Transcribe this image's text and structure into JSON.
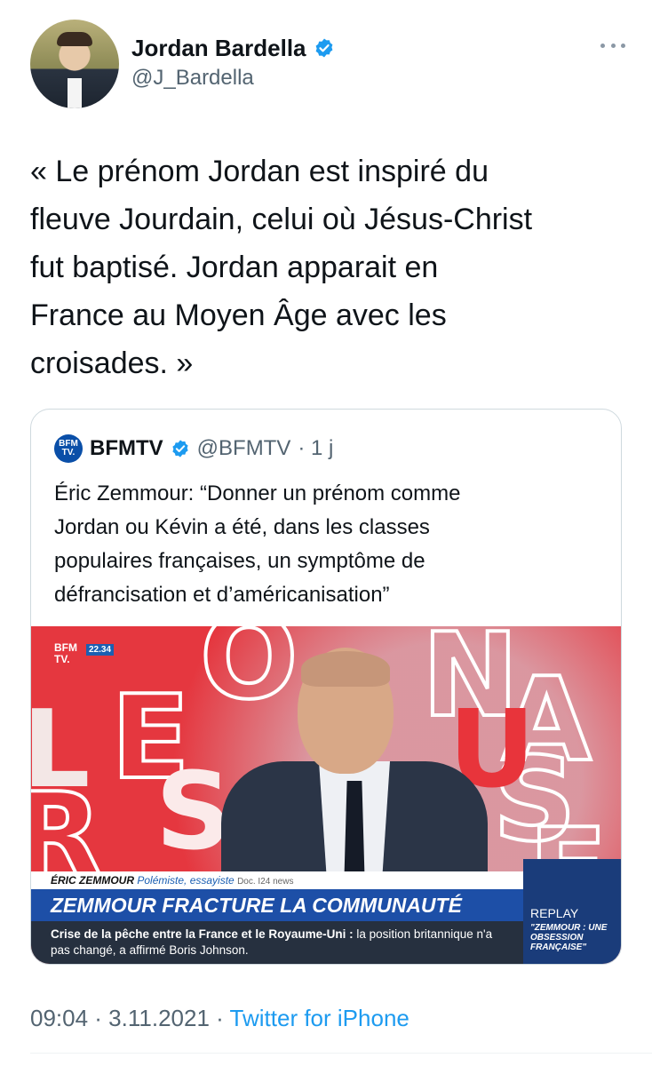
{
  "tweet": {
    "author": {
      "display_name": "Jordan Bardella",
      "handle": "@J_Bardella",
      "verified": true
    },
    "text": "« Le prénom Jordan est inspiré du\nfleuve Jourdain, celui où Jésus-Christ\nfut baptisé. Jordan apparait en\nFrance au Moyen Âge avec les\ncroisades. »",
    "timestamp": "09:04 · 3.11.2021 · ",
    "source": "Twitter for iPhone"
  },
  "quoted_tweet": {
    "logo_text": "BFM TV.",
    "display_name": "BFMTV",
    "handle": "@BFMTV",
    "age": "· 1 j",
    "text": "Éric Zemmour: “Donner un prénom comme\nJordan ou Kévin a été, dans les classes\npopulaires françaises, un symptôme de\ndéfrancisation et d’américanisation”",
    "media": {
      "channel_logo": "BFM TV.",
      "clock": "22.34",
      "lower_third_name": "ÉRIC ZEMMOUR",
      "lower_third_role": "Polémiste, essayiste",
      "lower_third_credit": "Doc. I24 news",
      "headline": "ZEMMOUR FRACTURE LA COMMUNAUTÉ JUIVE",
      "ticker_bold": "Crise de la pêche entre la France et le Royaume-Uni :",
      "ticker_rest": "la position britannique n'a pas changé, a affirmé Boris Johnson.",
      "replay_label": "REPLAY",
      "replay_title": "\"ZEMMOUR : UNE OBSESSION FRANÇAISE\""
    }
  },
  "colors": {
    "text": "#0f1419",
    "secondary": "#536471",
    "link": "#1d9bf0",
    "verified": "#1d9bf0",
    "border": "#cfd9de"
  }
}
